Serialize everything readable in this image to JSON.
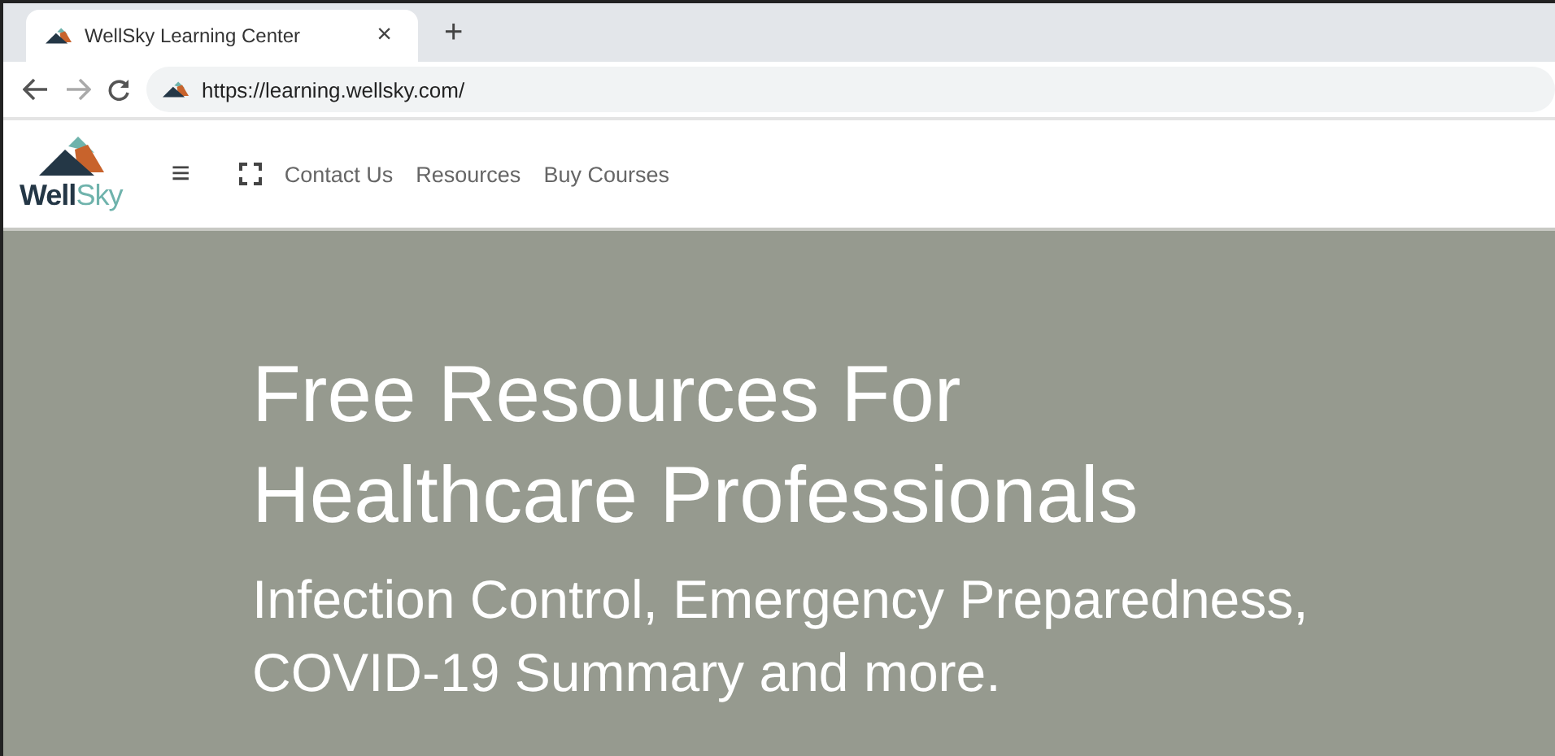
{
  "browser": {
    "tab": {
      "title": "WellSky Learning Center",
      "close": "×",
      "selected": true
    },
    "new_tab": "+",
    "address": "https://learning.wellsky.com/"
  },
  "header": {
    "logo": {
      "main": "Well",
      "accent": "Sky"
    },
    "menu": "≡",
    "nav": [
      "Contact Us",
      "Resources",
      "Buy Courses"
    ]
  },
  "hero": {
    "title_lines": [
      "Free Resources For",
      "Healthcare Professionals"
    ],
    "subtitle_lines": [
      "Infection Control, Emergency Preparedness,",
      "COVID-19 Summary and more."
    ]
  }
}
